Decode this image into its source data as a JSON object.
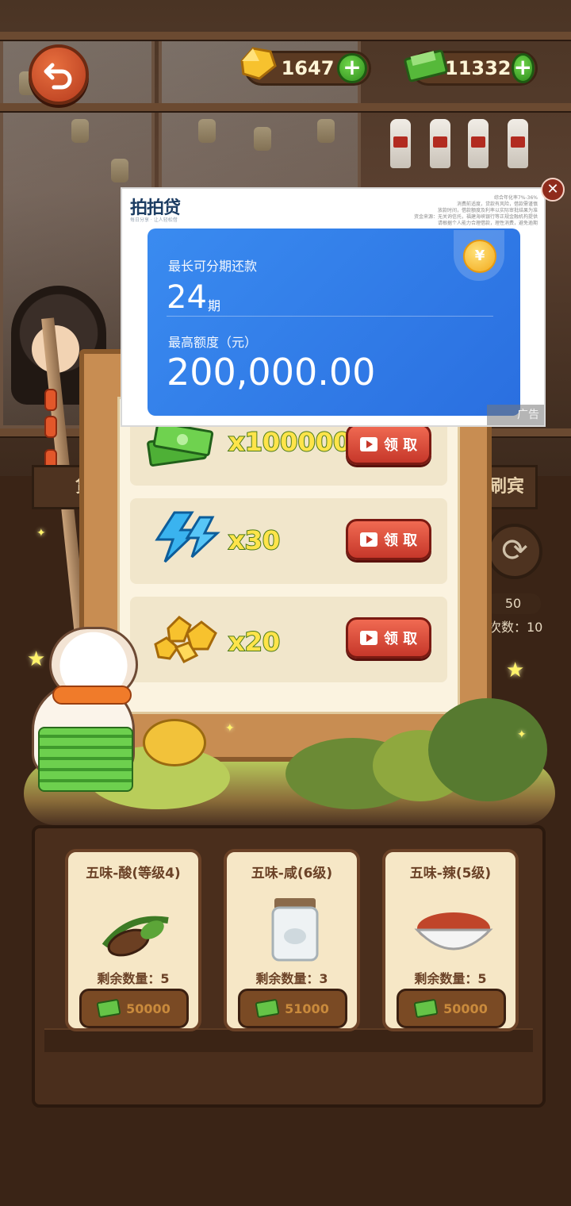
{
  "top_bar": {
    "gems": "1647",
    "cash": "11332"
  },
  "ad": {
    "brand": "拍拍贷",
    "brand_sub": "每日分享 · 让人轻松借",
    "disclaimer": "综合年化率7%-36%\n消费前适度，贷款有风险，借款需谨慎\n放款时间，借款额度及利率以实际审批结果为准\n资金来源：无关询信托，福建海峡银行等正规金融机构提供\n请根据个人能力合理借款，理性消费，避免逾期",
    "line1": "最长可分期还款",
    "installments": "24",
    "installments_unit": "期",
    "line2": "最高额度（元）",
    "amount": "200,000.00",
    "coin_symbol": "¥",
    "ad_tag": "广告"
  },
  "rewards": [
    {
      "icon": "cash-stack-icon",
      "qty": "x100000",
      "button": "领 取"
    },
    {
      "icon": "lightning-icon",
      "qty": "x30",
      "button": "领 取"
    },
    {
      "icon": "gold-nuggets-icon",
      "qty": "x20",
      "button": "领 取"
    }
  ],
  "side": {
    "left_tab": "贷",
    "right_tab": "刷宾",
    "count": "50",
    "times_label": "次数：10"
  },
  "items": [
    {
      "title": "五味-酸(等级4)",
      "remaining": "剩余数量：5",
      "price": "50000",
      "icon": "tamarind-icon"
    },
    {
      "title": "五味-咸(6级)",
      "remaining": "剩余数量：3",
      "price": "51000",
      "icon": "salt-jar-icon"
    },
    {
      "title": "五味-辣(5级)",
      "remaining": "剩余数量：5",
      "price": "50000",
      "icon": "chili-powder-icon"
    }
  ],
  "colors": {
    "ad_blue": "#2f7be8",
    "claim_red": "#d9432f",
    "wood": "#c88d52"
  }
}
